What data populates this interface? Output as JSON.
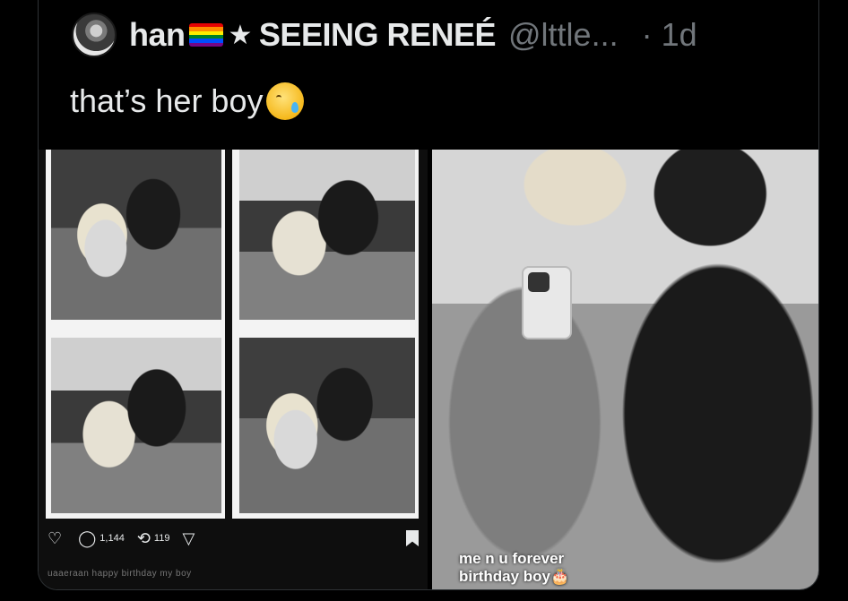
{
  "tweet": {
    "display_name": "han",
    "pride_flag": "pride-flag-icon",
    "name_suffix": "SEEING RENEÉ",
    "handle": "@lttle...",
    "timestamp": "· 1d",
    "text": "that’s her boy",
    "emoji": "crying-smile-emoji"
  },
  "left_screenshot": {
    "actions": {
      "replies": "1,144",
      "retweets": "119"
    },
    "caption_strip": "uaaeraan happy birthday my boy"
  },
  "right_screenshot": {
    "story_caption_line1": "me n u forever",
    "story_caption_line2": "birthday boy🎂"
  },
  "colors": {
    "background": "#000000",
    "text_primary": "#e7e9ea",
    "text_secondary": "#71767b",
    "border": "#2f3336"
  }
}
